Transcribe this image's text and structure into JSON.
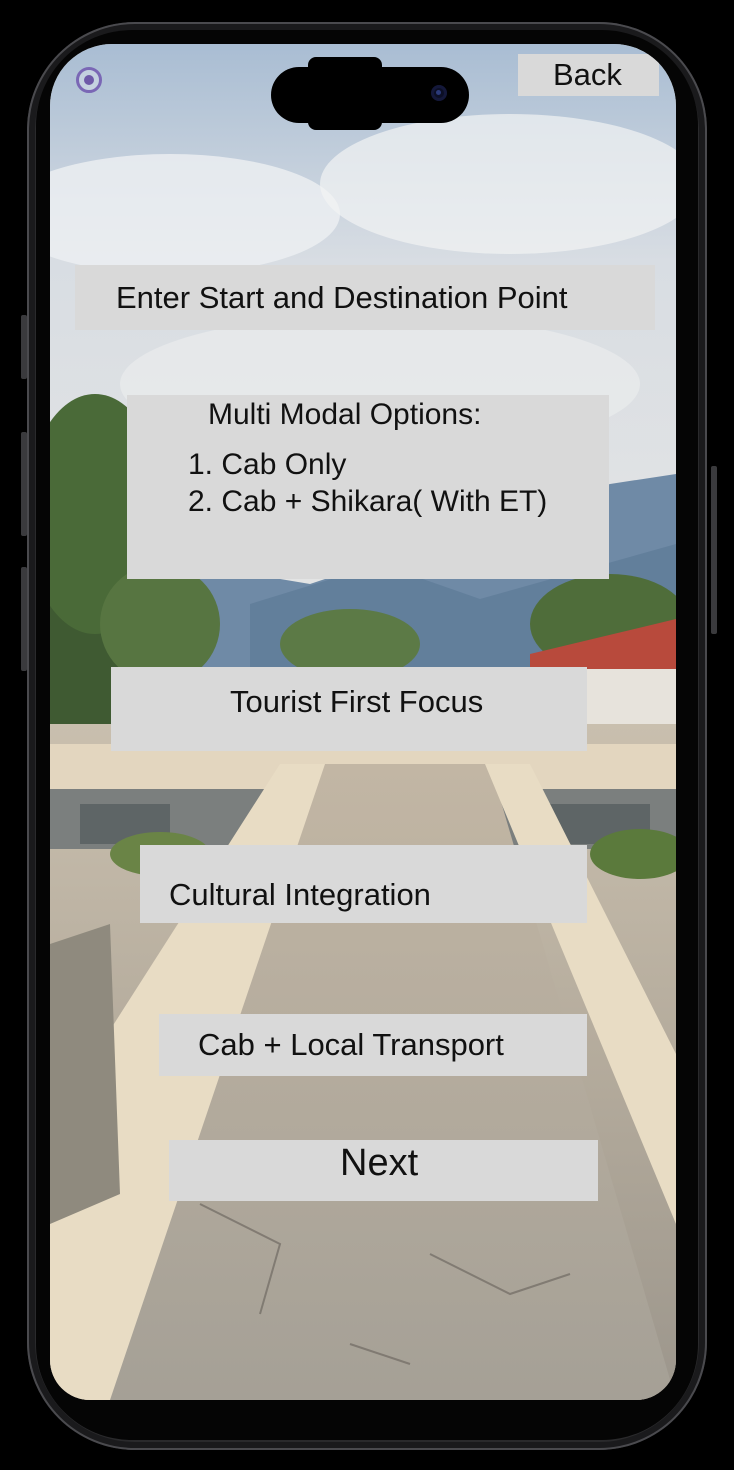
{
  "app": {
    "back_label": "Back",
    "start_destination_label": "Enter Start and Destination Point",
    "multi_modal": {
      "title": "Multi Modal Options:",
      "options": [
        "1. Cab Only",
        "2. Cab + Shikara( With ET)"
      ]
    },
    "tourist_first_focus_label": "Tourist First Focus",
    "cultural_integration_label": "Cultural Integration",
    "cab_local_transport_label": "Cab + Local Transport",
    "next_label": "Next"
  },
  "colors": {
    "button_background": "#d9d9d9",
    "text": "#111111",
    "radio_accent": "#6e5aa8",
    "device_frame": "#2a2a2c"
  },
  "background_image": "kashmir-garden-stone-walkway-with-mountains"
}
